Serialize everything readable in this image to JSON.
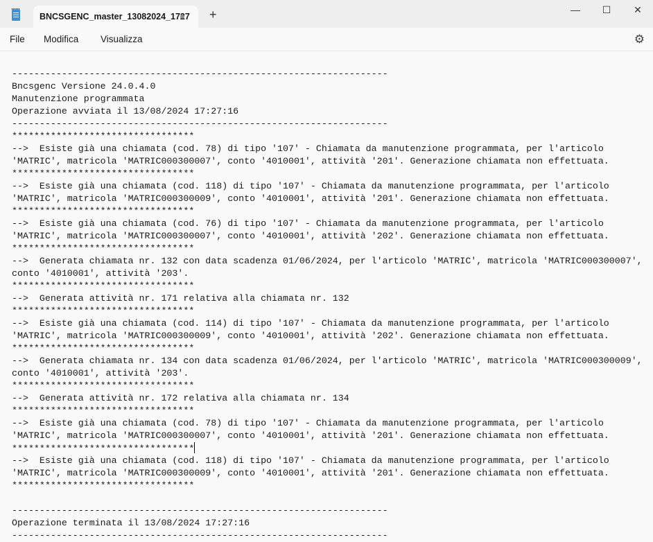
{
  "window": {
    "tab_title": "BNCSGENC_master_13082024_1727",
    "new_tab": "+",
    "minimize": "—",
    "maximize": "☐",
    "close": "✕",
    "app_icon": "notepad-icon"
  },
  "menu": {
    "file": "File",
    "edit": "Modifica",
    "view": "Visualizza",
    "settings_icon": "gear-icon"
  },
  "document": {
    "lines": [
      "",
      "--------------------------------------------------------------------",
      "Bncsgenc Versione 24.0.4.0",
      "Manutenzione programmata",
      "Operazione avviata il 13/08/2024 17:27:16",
      "--------------------------------------------------------------------",
      "*********************************",
      "-->  Esiste già una chiamata (cod. 78) di tipo '107' - Chiamata da manutenzione programmata, per l'articolo",
      "'MATRIC', matricola 'MATRIC000300007', conto '4010001', attività '201'. Generazione chiamata non effettuata.",
      "*********************************",
      "-->  Esiste già una chiamata (cod. 118) di tipo '107' - Chiamata da manutenzione programmata, per l'articolo",
      "'MATRIC', matricola 'MATRIC000300009', conto '4010001', attività '201'. Generazione chiamata non effettuata.",
      "*********************************",
      "-->  Esiste già una chiamata (cod. 76) di tipo '107' - Chiamata da manutenzione programmata, per l'articolo",
      "'MATRIC', matricola 'MATRIC000300007', conto '4010001', attività '202'. Generazione chiamata non effettuata.",
      "*********************************",
      "-->  Generata chiamata nr. 132 con data scadenza 01/06/2024, per l'articolo 'MATRIC', matricola 'MATRIC000300007',",
      "conto '4010001', attività '203'.",
      "*********************************",
      "-->  Generata attività nr. 171 relativa alla chiamata nr. 132",
      "*********************************",
      "-->  Esiste già una chiamata (cod. 114) di tipo '107' - Chiamata da manutenzione programmata, per l'articolo",
      "'MATRIC', matricola 'MATRIC000300009', conto '4010001', attività '202'. Generazione chiamata non effettuata.",
      "*********************************",
      "-->  Generata chiamata nr. 134 con data scadenza 01/06/2024, per l'articolo 'MATRIC', matricola 'MATRIC000300009',",
      "conto '4010001', attività '203'.",
      "*********************************",
      "-->  Generata attività nr. 172 relativa alla chiamata nr. 134",
      "*********************************",
      "-->  Esiste già una chiamata (cod. 78) di tipo '107' - Chiamata da manutenzione programmata, per l'articolo",
      "'MATRIC', matricola 'MATRIC000300007', conto '4010001', attività '201'. Generazione chiamata non effettuata.",
      "*********************************",
      "-->  Esiste già una chiamata (cod. 118) di tipo '107' - Chiamata da manutenzione programmata, per l'articolo",
      "'MATRIC', matricola 'MATRIC000300009', conto '4010001', attività '201'. Generazione chiamata non effettuata.",
      "*********************************",
      "",
      "--------------------------------------------------------------------",
      "Operazione terminata il 13/08/2024 17:27:16",
      "--------------------------------------------------------------------"
    ]
  }
}
